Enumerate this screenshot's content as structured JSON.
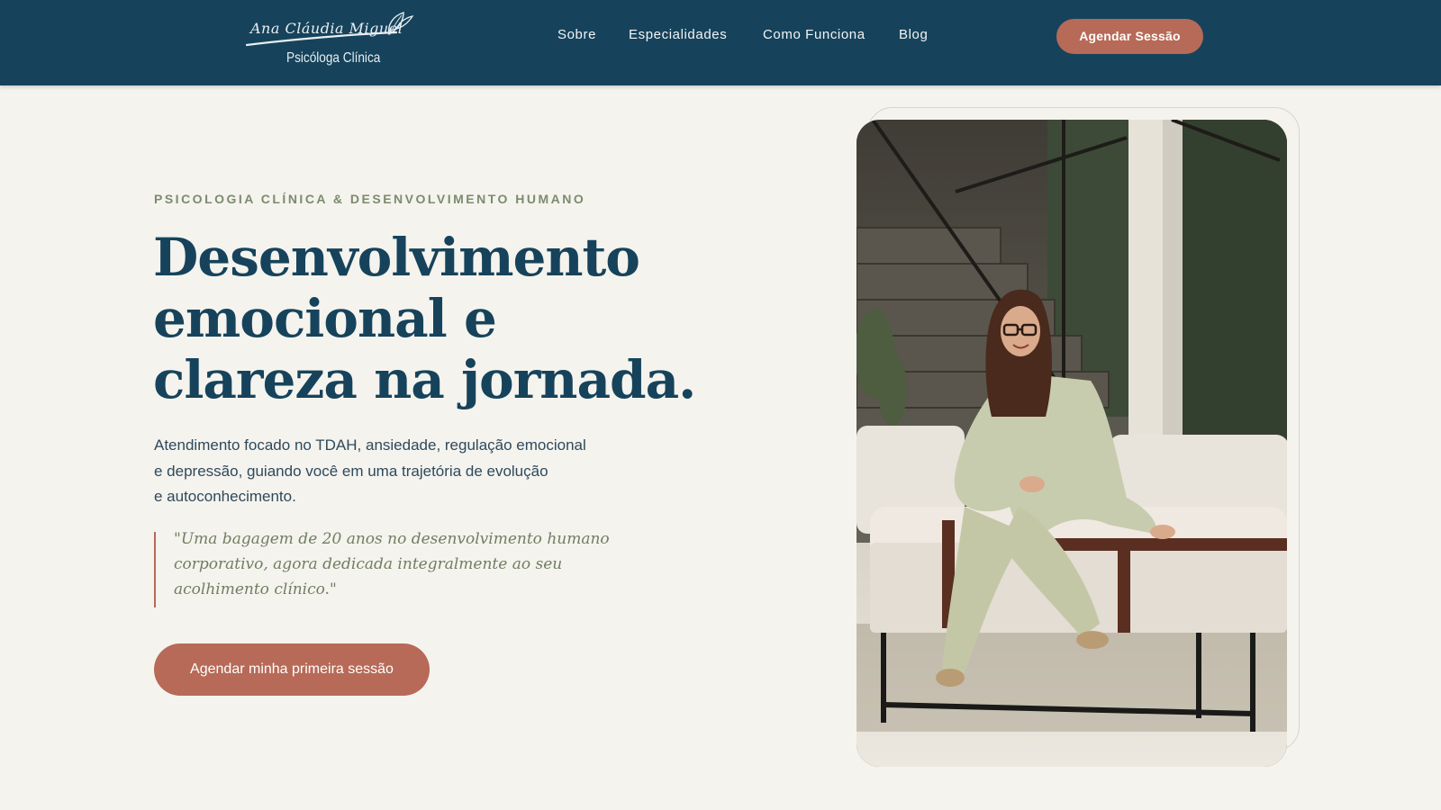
{
  "header": {
    "logo": {
      "script_name": "Ana Cláudia Miguel",
      "subtitle": "Psicóloga Clínica"
    },
    "nav": [
      {
        "label": "Sobre"
      },
      {
        "label": "Especialidades"
      },
      {
        "label": "Como Funciona"
      },
      {
        "label": "Blog"
      }
    ],
    "cta_label": "Agendar Sessão"
  },
  "hero": {
    "eyebrow": "PSICOLOGIA CLÍNICA & DESENVOLVIMENTO HUMANO",
    "headline": [
      "Desenvolvimento",
      "emocional e",
      "clareza na jornada."
    ],
    "lead": [
      "Atendimento focado no TDAH, ansiedade, regulação emocional",
      "e depressão, guiando você em uma trajetória de evolução",
      "e autoconhecimento."
    ],
    "quote": [
      "\"Uma bagagem de 20 anos no desenvolvimento humano",
      "corporativo, agora dedicada integralmente ao seu",
      "acolhimento clínico.\""
    ],
    "cta_label": "Agendar minha primeira sessão"
  },
  "colors": {
    "navy": "#16435b",
    "terracotta": "#b76a57",
    "sage": "#7c8b6f",
    "background": "#f5f3ee"
  },
  "icons": [
    "leaf-logo-icon"
  ]
}
